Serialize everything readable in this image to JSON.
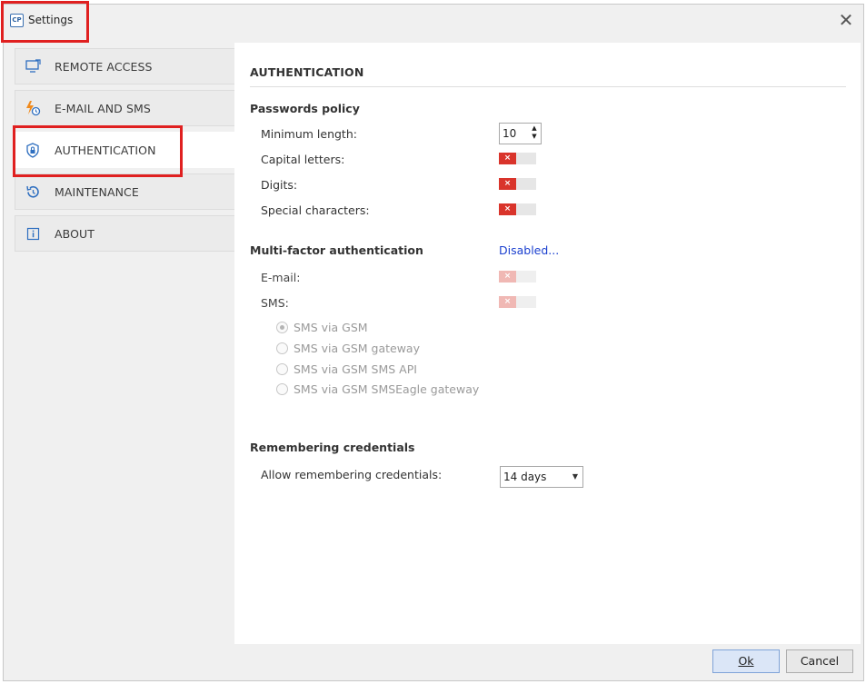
{
  "window": {
    "title": "Settings",
    "app_icon_text": "CP"
  },
  "nav": {
    "items": [
      {
        "label": "REMOTE ACCESS",
        "icon": "monitor-remote-icon"
      },
      {
        "label": "E-MAIL AND SMS",
        "icon": "lightning-clock-icon"
      },
      {
        "label": "AUTHENTICATION",
        "icon": "shield-lock-icon",
        "active": true
      },
      {
        "label": "MAINTENANCE",
        "icon": "restore-clock-icon"
      },
      {
        "label": "ABOUT",
        "icon": "info-icon"
      }
    ]
  },
  "content": {
    "title": "AUTHENTICATION",
    "passwords_policy": {
      "title": "Passwords policy",
      "min_length_label": "Minimum length:",
      "min_length_value": "10",
      "capital_label": "Capital letters:",
      "digits_label": "Digits:",
      "special_label": "Special characters:",
      "toggle_off_symbol": "×"
    },
    "mfa": {
      "title": "Multi-factor authentication",
      "status_link": "Disabled...",
      "email_label": "E-mail:",
      "sms_label": "SMS:",
      "sms_options": [
        {
          "label": "SMS via GSM",
          "checked": true
        },
        {
          "label": "SMS via GSM gateway",
          "checked": false
        },
        {
          "label": "SMS via GSM SMS API",
          "checked": false
        },
        {
          "label": "SMS via GSM SMSEagle gateway",
          "checked": false
        }
      ]
    },
    "remembering": {
      "title": "Remembering credentials",
      "allow_label": "Allow remembering credentials:",
      "selected": "14 days"
    }
  },
  "footer": {
    "ok_label": "Ok",
    "cancel_label": "Cancel"
  },
  "colors": {
    "highlight": "#e02020",
    "toggle_off": "#d9342b",
    "link": "#1a3fcf",
    "accent_icon": "#2f6fc0"
  }
}
